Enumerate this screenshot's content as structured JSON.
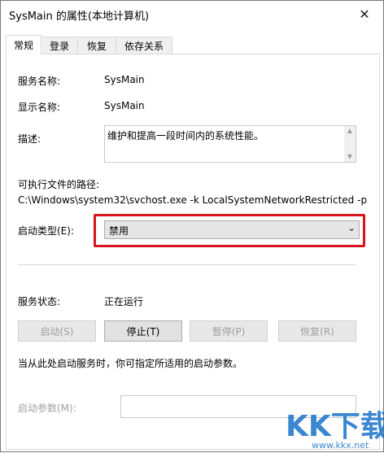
{
  "window": {
    "title": "SysMain 的属性(本地计算机)",
    "close_glyph": "✕"
  },
  "tabs": [
    {
      "label": "常规",
      "active": true
    },
    {
      "label": "登录",
      "active": false
    },
    {
      "label": "恢复",
      "active": false
    },
    {
      "label": "依存关系",
      "active": false
    }
  ],
  "general": {
    "service_name_label": "服务名称:",
    "service_name": "SysMain",
    "display_name_label": "显示名称:",
    "display_name": "SysMain",
    "description_label": "描述:",
    "description": "维护和提高一段时间内的系统性能。",
    "exe_path_label": "可执行文件的路径:",
    "exe_path": "C:\\Windows\\system32\\svchost.exe -k LocalSystemNetworkRestricted -p",
    "startup_type_label": "启动类型(E):",
    "startup_type_value": "禁用",
    "status_label": "服务状态:",
    "status_value": "正在运行",
    "buttons": {
      "start": "启动(S)",
      "stop": "停止(T)",
      "pause": "暂停(P)",
      "resume": "恢复(R)"
    },
    "hint": "当从此处启动服务时，你可指定所适用的启动参数。",
    "params_label": "启动参数(M):",
    "params_value": ""
  },
  "watermark": {
    "text": "KK下载",
    "url": "www.kkx.net"
  },
  "colors": {
    "highlight_border": "#d8141f",
    "watermark": "#1a73c9"
  }
}
